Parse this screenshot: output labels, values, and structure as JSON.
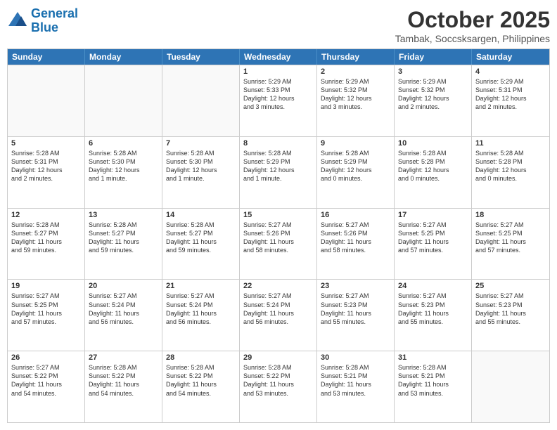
{
  "logo": {
    "line1": "General",
    "line2": "Blue"
  },
  "title": "October 2025",
  "location": "Tambak, Soccsksargen, Philippines",
  "header_days": [
    "Sunday",
    "Monday",
    "Tuesday",
    "Wednesday",
    "Thursday",
    "Friday",
    "Saturday"
  ],
  "weeks": [
    [
      {
        "day": "",
        "text": ""
      },
      {
        "day": "",
        "text": ""
      },
      {
        "day": "",
        "text": ""
      },
      {
        "day": "1",
        "text": "Sunrise: 5:29 AM\nSunset: 5:33 PM\nDaylight: 12 hours\nand 3 minutes."
      },
      {
        "day": "2",
        "text": "Sunrise: 5:29 AM\nSunset: 5:32 PM\nDaylight: 12 hours\nand 3 minutes."
      },
      {
        "day": "3",
        "text": "Sunrise: 5:29 AM\nSunset: 5:32 PM\nDaylight: 12 hours\nand 2 minutes."
      },
      {
        "day": "4",
        "text": "Sunrise: 5:29 AM\nSunset: 5:31 PM\nDaylight: 12 hours\nand 2 minutes."
      }
    ],
    [
      {
        "day": "5",
        "text": "Sunrise: 5:28 AM\nSunset: 5:31 PM\nDaylight: 12 hours\nand 2 minutes."
      },
      {
        "day": "6",
        "text": "Sunrise: 5:28 AM\nSunset: 5:30 PM\nDaylight: 12 hours\nand 1 minute."
      },
      {
        "day": "7",
        "text": "Sunrise: 5:28 AM\nSunset: 5:30 PM\nDaylight: 12 hours\nand 1 minute."
      },
      {
        "day": "8",
        "text": "Sunrise: 5:28 AM\nSunset: 5:29 PM\nDaylight: 12 hours\nand 1 minute."
      },
      {
        "day": "9",
        "text": "Sunrise: 5:28 AM\nSunset: 5:29 PM\nDaylight: 12 hours\nand 0 minutes."
      },
      {
        "day": "10",
        "text": "Sunrise: 5:28 AM\nSunset: 5:28 PM\nDaylight: 12 hours\nand 0 minutes."
      },
      {
        "day": "11",
        "text": "Sunrise: 5:28 AM\nSunset: 5:28 PM\nDaylight: 12 hours\nand 0 minutes."
      }
    ],
    [
      {
        "day": "12",
        "text": "Sunrise: 5:28 AM\nSunset: 5:27 PM\nDaylight: 11 hours\nand 59 minutes."
      },
      {
        "day": "13",
        "text": "Sunrise: 5:28 AM\nSunset: 5:27 PM\nDaylight: 11 hours\nand 59 minutes."
      },
      {
        "day": "14",
        "text": "Sunrise: 5:28 AM\nSunset: 5:27 PM\nDaylight: 11 hours\nand 59 minutes."
      },
      {
        "day": "15",
        "text": "Sunrise: 5:27 AM\nSunset: 5:26 PM\nDaylight: 11 hours\nand 58 minutes."
      },
      {
        "day": "16",
        "text": "Sunrise: 5:27 AM\nSunset: 5:26 PM\nDaylight: 11 hours\nand 58 minutes."
      },
      {
        "day": "17",
        "text": "Sunrise: 5:27 AM\nSunset: 5:25 PM\nDaylight: 11 hours\nand 57 minutes."
      },
      {
        "day": "18",
        "text": "Sunrise: 5:27 AM\nSunset: 5:25 PM\nDaylight: 11 hours\nand 57 minutes."
      }
    ],
    [
      {
        "day": "19",
        "text": "Sunrise: 5:27 AM\nSunset: 5:25 PM\nDaylight: 11 hours\nand 57 minutes."
      },
      {
        "day": "20",
        "text": "Sunrise: 5:27 AM\nSunset: 5:24 PM\nDaylight: 11 hours\nand 56 minutes."
      },
      {
        "day": "21",
        "text": "Sunrise: 5:27 AM\nSunset: 5:24 PM\nDaylight: 11 hours\nand 56 minutes."
      },
      {
        "day": "22",
        "text": "Sunrise: 5:27 AM\nSunset: 5:24 PM\nDaylight: 11 hours\nand 56 minutes."
      },
      {
        "day": "23",
        "text": "Sunrise: 5:27 AM\nSunset: 5:23 PM\nDaylight: 11 hours\nand 55 minutes."
      },
      {
        "day": "24",
        "text": "Sunrise: 5:27 AM\nSunset: 5:23 PM\nDaylight: 11 hours\nand 55 minutes."
      },
      {
        "day": "25",
        "text": "Sunrise: 5:27 AM\nSunset: 5:23 PM\nDaylight: 11 hours\nand 55 minutes."
      }
    ],
    [
      {
        "day": "26",
        "text": "Sunrise: 5:27 AM\nSunset: 5:22 PM\nDaylight: 11 hours\nand 54 minutes."
      },
      {
        "day": "27",
        "text": "Sunrise: 5:28 AM\nSunset: 5:22 PM\nDaylight: 11 hours\nand 54 minutes."
      },
      {
        "day": "28",
        "text": "Sunrise: 5:28 AM\nSunset: 5:22 PM\nDaylight: 11 hours\nand 54 minutes."
      },
      {
        "day": "29",
        "text": "Sunrise: 5:28 AM\nSunset: 5:22 PM\nDaylight: 11 hours\nand 53 minutes."
      },
      {
        "day": "30",
        "text": "Sunrise: 5:28 AM\nSunset: 5:21 PM\nDaylight: 11 hours\nand 53 minutes."
      },
      {
        "day": "31",
        "text": "Sunrise: 5:28 AM\nSunset: 5:21 PM\nDaylight: 11 hours\nand 53 minutes."
      },
      {
        "day": "",
        "text": ""
      }
    ]
  ]
}
